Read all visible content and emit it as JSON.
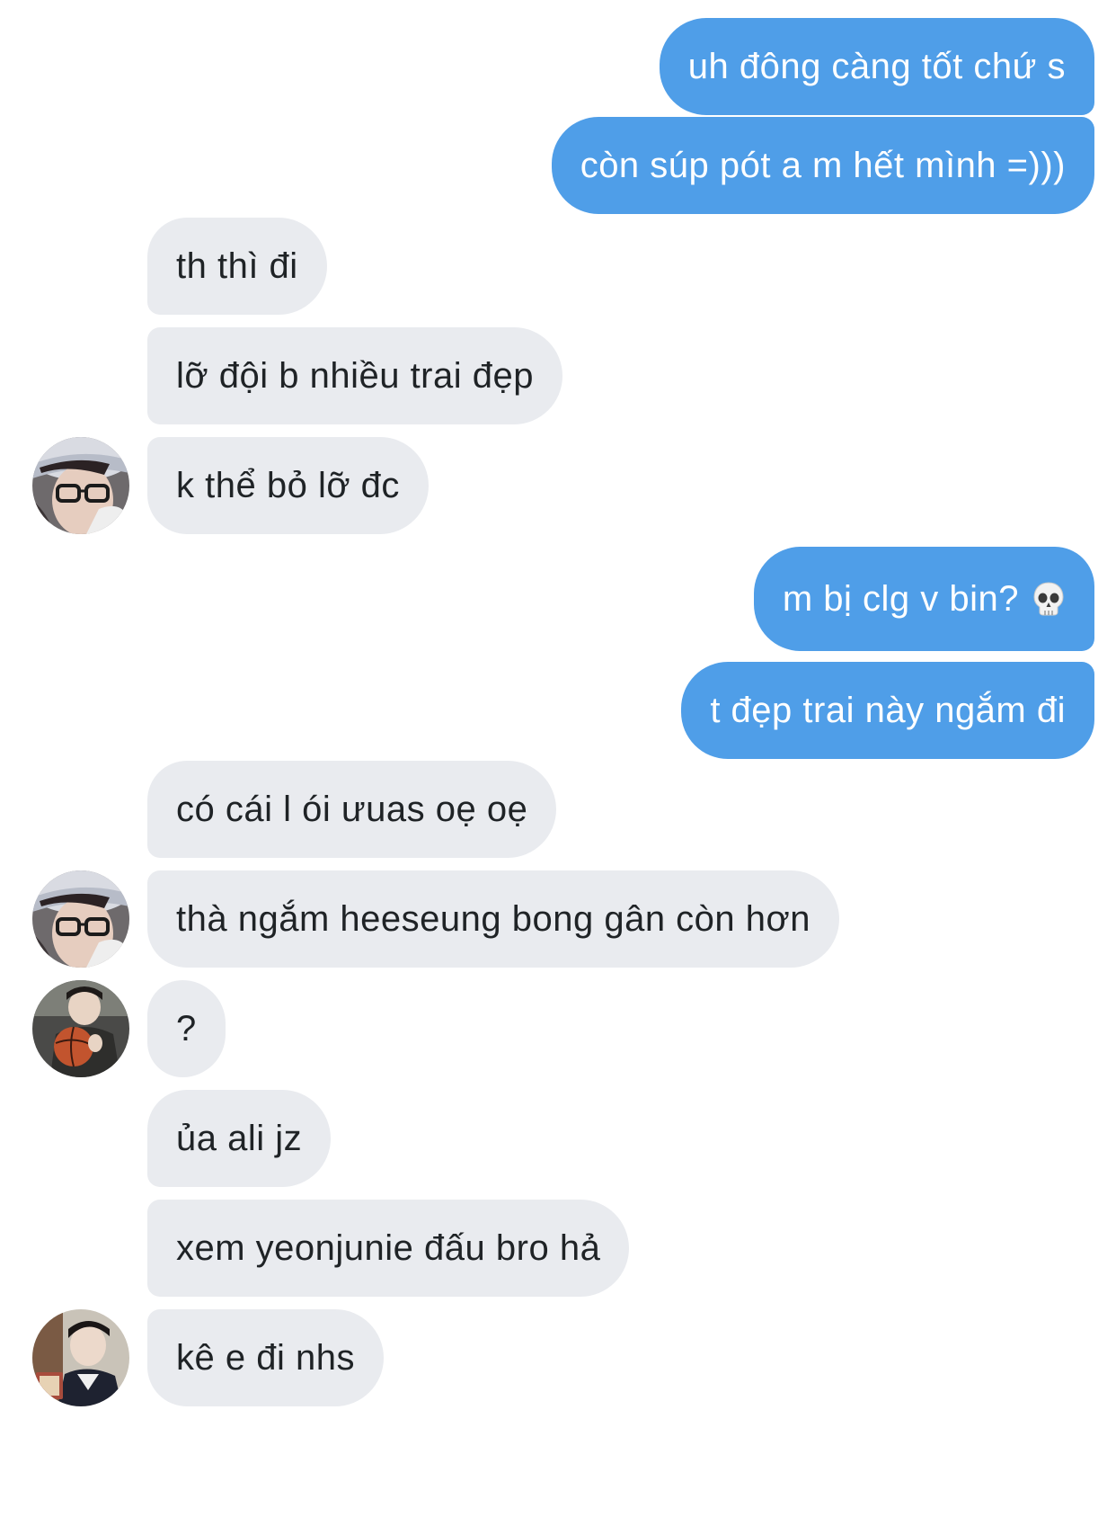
{
  "conversation": {
    "messages": [
      {
        "id": "m1",
        "direction": "sent",
        "text": "uh đông càng tốt chứ s"
      },
      {
        "id": "m2",
        "direction": "sent",
        "text": "còn súp pót a m hết mình =)))"
      },
      {
        "id": "m3",
        "direction": "received",
        "text": "th thì đi"
      },
      {
        "id": "m4",
        "direction": "received",
        "text": "lỡ đội b nhiều trai đẹp"
      },
      {
        "id": "m5",
        "direction": "received",
        "text": "k thể bỏ lỡ đc",
        "avatar": "avatar-glasses-beanie"
      },
      {
        "id": "m6",
        "direction": "sent",
        "text": "m bị clg v bin?",
        "emoji": "skull-emoji"
      },
      {
        "id": "m7",
        "direction": "sent",
        "text": "t đẹp trai này ngắm đi"
      },
      {
        "id": "m8",
        "direction": "received",
        "text": "có cái l ói ưuas oẹ oẹ"
      },
      {
        "id": "m9",
        "direction": "received",
        "text": "thà ngắm heeseung bong gân còn hơn",
        "avatar": "avatar-glasses-beanie"
      },
      {
        "id": "m10",
        "direction": "received",
        "text": "?",
        "avatar": "avatar-basketball"
      },
      {
        "id": "m11",
        "direction": "received",
        "text": "ủa ali jz"
      },
      {
        "id": "m12",
        "direction": "received",
        "text": "xem yeonjunie đấu bro hả"
      },
      {
        "id": "m13",
        "direction": "received",
        "text": "kê e đi nhs",
        "avatar": "avatar-book"
      }
    ]
  },
  "colors": {
    "sent_bubble": "#4f9ee8",
    "received_bubble": "#e9ebef",
    "sent_text": "#ffffff",
    "received_text": "#1f2326"
  }
}
